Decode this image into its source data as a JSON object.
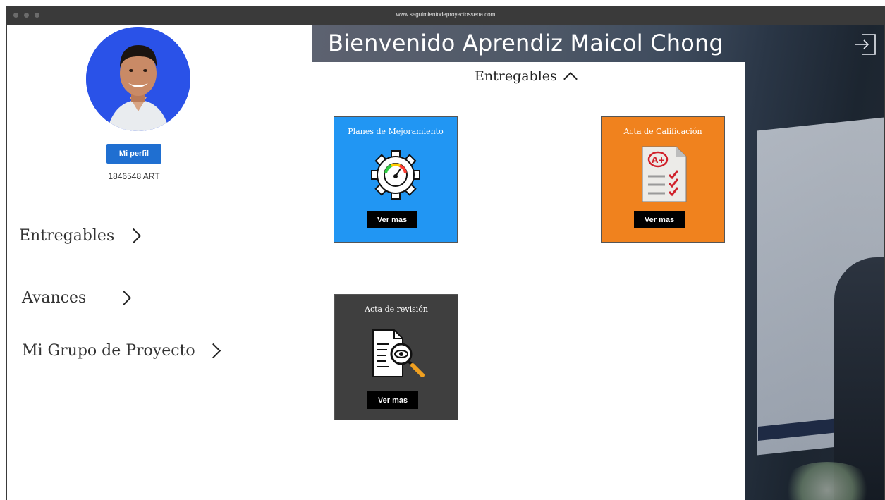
{
  "browser": {
    "url": "www.seguimientodeproyectossena.com"
  },
  "sidebar": {
    "profile_button": "Mi perfil",
    "user_code": "1846548 ART",
    "items": [
      {
        "label": "Entregables"
      },
      {
        "label": "Avances"
      },
      {
        "label": "Mi Grupo de Proyecto"
      }
    ]
  },
  "header": {
    "welcome": "Bienvenido Aprendiz Maicol Chong",
    "logout_icon": "logout-icon"
  },
  "main": {
    "section_title": "Entregables",
    "cards": [
      {
        "title": "Planes de Mejoramiento",
        "button": "Ver mas",
        "icon": "gear-gauge-icon",
        "color": "#2196f3"
      },
      {
        "title": "Acta de Calificación",
        "button": "Ver mas",
        "icon": "graded-document-icon",
        "color": "#f0821e"
      },
      {
        "title": "Acta de revisión",
        "button": "Ver mas",
        "icon": "document-review-icon",
        "color": "#3f3f3f"
      }
    ]
  },
  "colors": {
    "profile_button": "#1f6fd1",
    "avatar_bg": "#2a52e8"
  }
}
